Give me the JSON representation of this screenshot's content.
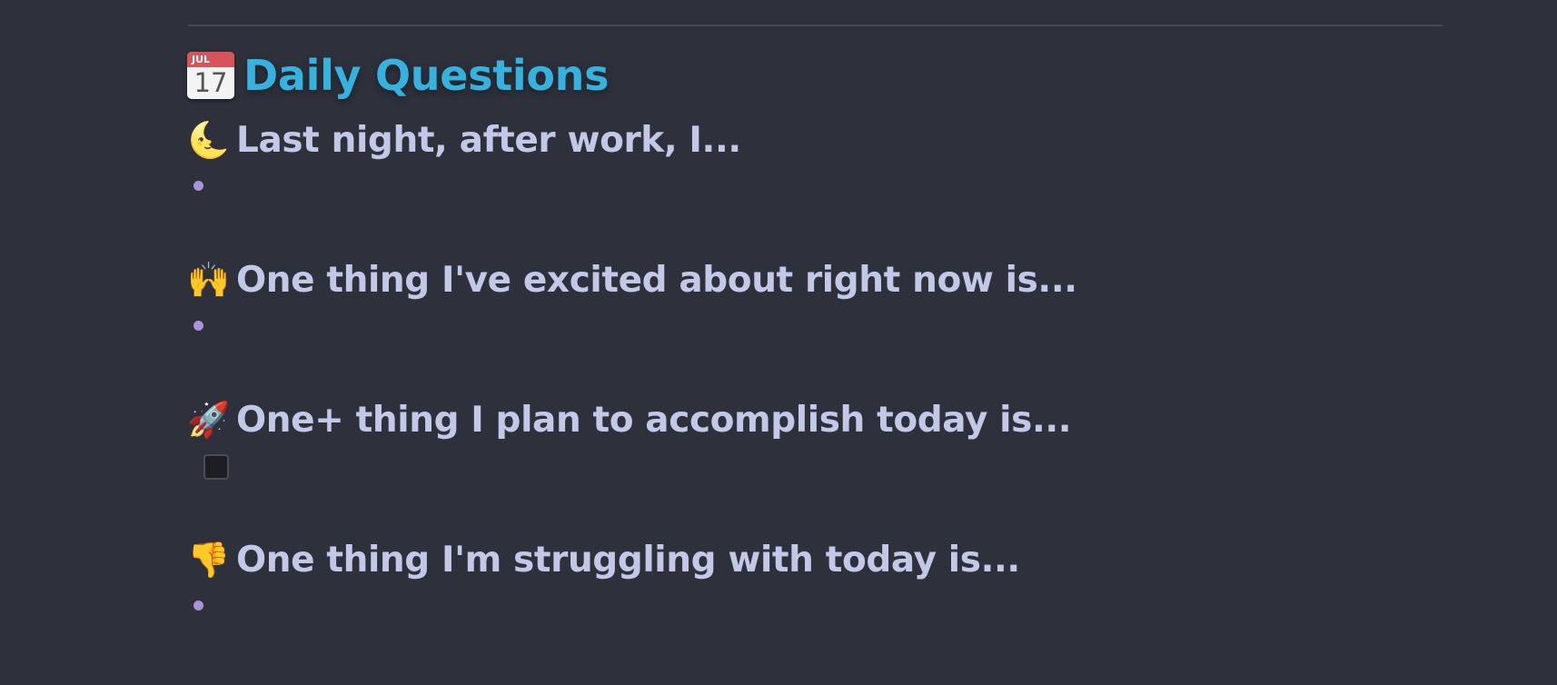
{
  "header": {
    "title": "Daily Questions",
    "icon": "calendar-icon",
    "calendar_month": "JUL",
    "calendar_day": "17",
    "title_color": "#35b3de"
  },
  "questions": [
    {
      "icon": "moon-icon",
      "emoji": "🌜",
      "text": "Last night, after work, I...",
      "item_type": "bullet"
    },
    {
      "icon": "raised-hands-icon",
      "emoji": "🙌",
      "text": "One thing I've excited about right now is...",
      "item_type": "bullet"
    },
    {
      "icon": "rocket-icon",
      "emoji": "🚀",
      "text": "One+ thing I plan to accomplish today is...",
      "item_type": "checkbox",
      "checked": false
    },
    {
      "icon": "thumbs-down-icon",
      "emoji": "👎",
      "text": "One thing I'm struggling with today is...",
      "item_type": "bullet"
    }
  ],
  "colors": {
    "background": "#2e303b",
    "question_text": "#c3c8e6",
    "bullet": "#a793d8"
  }
}
